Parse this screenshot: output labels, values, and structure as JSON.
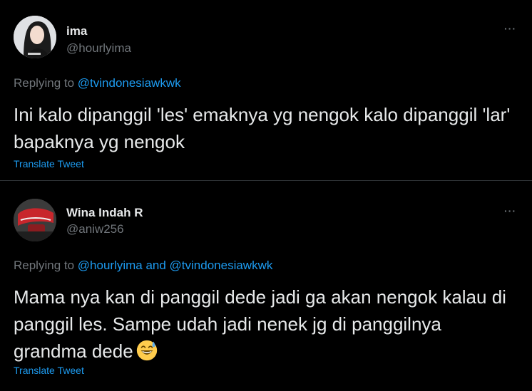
{
  "tweets": [
    {
      "name": "ima",
      "handle": "@hourlyima",
      "more": "···",
      "replying_prefix": "Replying to ",
      "replying_mentions": "@tvindonesiawkwk",
      "text": "Ini kalo dipanggil 'les' emaknya yg nengok kalo dipanggil 'lar' bapaknya yg nengok",
      "translate": "Translate Tweet"
    },
    {
      "name": "Wina Indah R",
      "handle": "@aniw256",
      "more": "···",
      "replying_prefix": "Replying to ",
      "replying_mentions": "@hourlyima and @tvindonesiawkwk",
      "text": "Mama nya kan di panggil dede jadi ga akan nengok kalau di panggil les. Sampe udah jadi nenek jg di panggilnya grandma dede",
      "emoji": "grinning-face-with-sweat",
      "translate": "Translate Tweet"
    }
  ],
  "colors": {
    "background": "#000000",
    "text": "#e7e9ea",
    "secondary": "#71767b",
    "link": "#1d9bf0",
    "divider": "#2f3336"
  }
}
